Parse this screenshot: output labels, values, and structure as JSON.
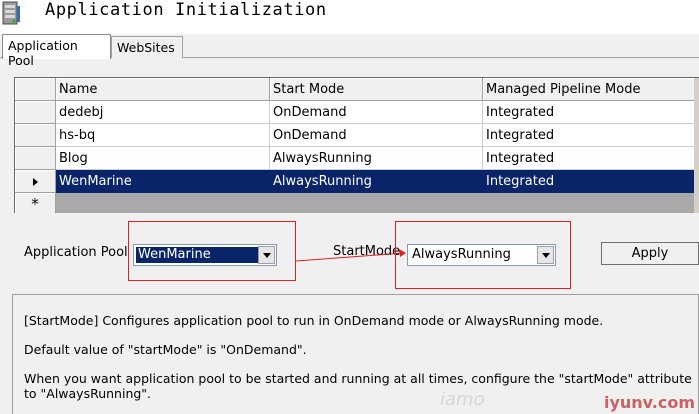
{
  "header": {
    "title": "Application Initialization",
    "icon": "server-icon"
  },
  "tabs": [
    {
      "label": "Application Pool",
      "active": true
    },
    {
      "label": "WebSites",
      "active": false
    }
  ],
  "grid": {
    "columns": [
      "Name",
      "Start Mode",
      "Managed Pipeline Mode"
    ],
    "rows": [
      {
        "name": "dedebj",
        "start_mode": "OnDemand",
        "pipeline": "Integrated",
        "selected": false
      },
      {
        "name": "hs-bq",
        "start_mode": "OnDemand",
        "pipeline": "Integrated",
        "selected": false
      },
      {
        "name": "Blog",
        "start_mode": "AlwaysRunning",
        "pipeline": "Integrated",
        "selected": false
      },
      {
        "name": "WenMarine",
        "start_mode": "AlwaysRunning",
        "pipeline": "Integrated",
        "selected": true
      }
    ],
    "new_row_marker": "*"
  },
  "form": {
    "pool_label": "Application Pool",
    "pool_value": "WenMarine",
    "startmode_label": "StartMode",
    "startmode_value": "AlwaysRunning",
    "apply_label": "Apply"
  },
  "description": {
    "line1": "[StartMode] Configures application pool to run in OnDemand mode or AlwaysRunning mode.",
    "line2": "Default value of \"startMode\" is \"OnDemand\".",
    "line3": "When you want application pool to be started and running at all times, configure the \"startMode\" attribute",
    "line4": "to \"AlwaysRunning\"."
  },
  "watermark": {
    "faint": "iamo",
    "brand": "iyunv.com"
  },
  "colors": {
    "selection": "#0a246a",
    "highlight_box": "#e02020"
  }
}
